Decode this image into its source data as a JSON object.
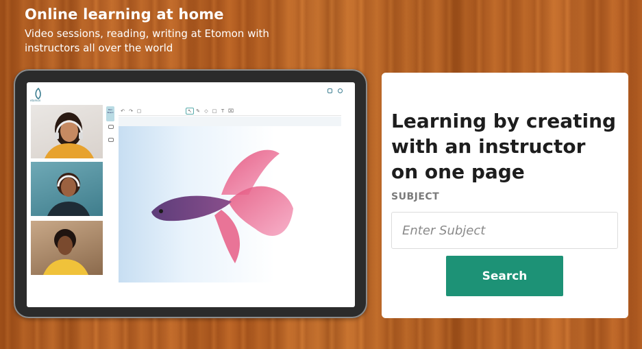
{
  "hero": {
    "title": "Online learning at home",
    "subtitle": "Video sessions, reading, writing at Etomon with instructors all over the world"
  },
  "tablet": {
    "app_logo_text": "etomon",
    "tool_label": "Mini Board",
    "toolbar_icons": [
      "undo-icon",
      "redo-icon",
      "copy-icon",
      "cursor-icon",
      "pen-icon",
      "eraser-icon",
      "shape-icon",
      "text-icon",
      "trash-icon"
    ]
  },
  "search_card": {
    "heading": "Learning by creating with an instructor on one page",
    "subject_label": "SUBJECT",
    "subject_placeholder": "Enter Subject",
    "subject_value": "",
    "search_label": "Search"
  },
  "colors": {
    "accent": "#1d9276",
    "wood": "#b8601f"
  }
}
